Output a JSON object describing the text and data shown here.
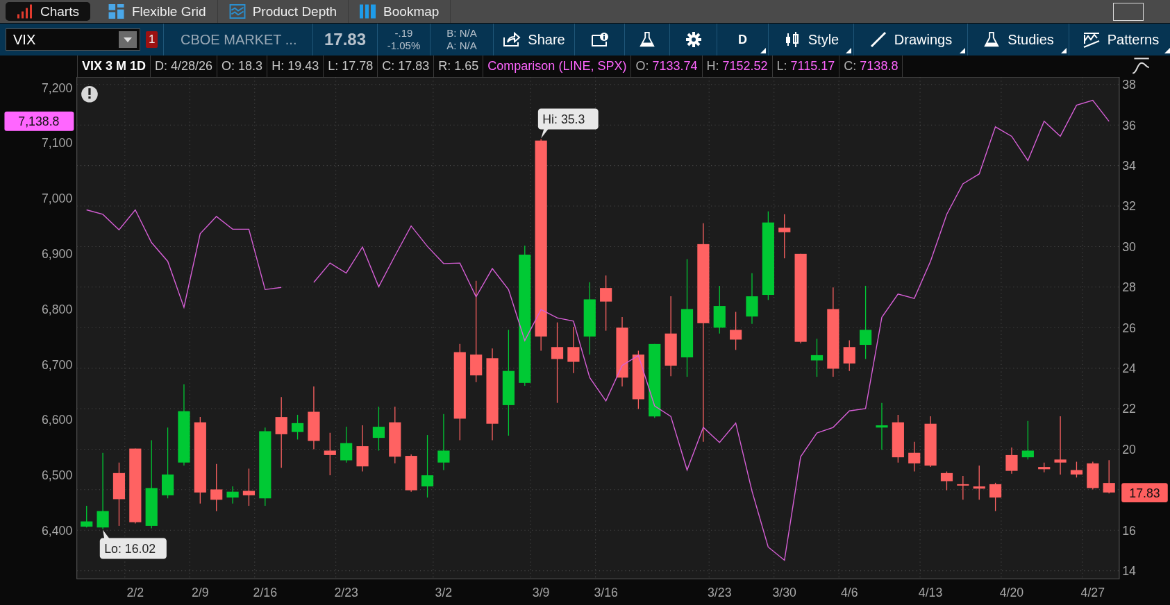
{
  "tabs": [
    {
      "label": "Charts",
      "kind": "charts",
      "selected": true
    },
    {
      "label": "Flexible Grid",
      "kind": "grid",
      "selected": false
    },
    {
      "label": "Product Depth",
      "kind": "depth",
      "selected": false
    },
    {
      "label": "Bookmap",
      "kind": "bookmap",
      "selected": false
    }
  ],
  "toolbar": {
    "symbol": "VIX",
    "alert_count": "1",
    "description": "CBOE MARKET ...",
    "last": "17.83",
    "change": "-.19",
    "change_pct": "-1.05%",
    "bid": "B: N/A",
    "ask": "A: N/A",
    "buttons": [
      {
        "kind": "share",
        "label": "Share",
        "dropdown": false
      },
      {
        "kind": "info",
        "dropdown": false
      },
      {
        "kind": "flask",
        "dropdown": false
      },
      {
        "kind": "gear",
        "dropdown": false
      },
      {
        "kind": "text",
        "label": "D",
        "dropdown": true
      },
      {
        "kind": "style",
        "label": "Style",
        "dropdown": true
      },
      {
        "kind": "drawings",
        "label": "Drawings",
        "dropdown": true
      },
      {
        "kind": "studies",
        "label": "Studies",
        "dropdown": true
      },
      {
        "kind": "patterns",
        "label": "Patterns",
        "dropdown": true
      }
    ]
  },
  "header": {
    "title": "VIX 3 M 1D",
    "fields": [
      "D: 4/28/26",
      "O: 18.3",
      "H: 19.43",
      "L: 17.78",
      "C: 17.83",
      "R: 1.65"
    ],
    "comparison": {
      "label": "Comparison (LINE, SPX)",
      "fields": [
        {
          "name": "O:",
          "value": "7133.74"
        },
        {
          "name": "H:",
          "value": "7152.52"
        },
        {
          "name": "L:",
          "value": "7115.17"
        },
        {
          "name": "C:",
          "value": "7138.8"
        }
      ]
    }
  },
  "chart": {
    "callouts": [
      "Hi: 35.3",
      "Lo: 16.02"
    ],
    "right_axis": [
      {
        "kind": "label",
        "text": "38"
      },
      {
        "kind": "label",
        "text": "36"
      },
      {
        "kind": "label",
        "text": "34"
      },
      {
        "kind": "label",
        "text": "32"
      },
      {
        "kind": "label",
        "text": "30"
      },
      {
        "kind": "label",
        "text": "28"
      },
      {
        "kind": "label",
        "text": "26"
      },
      {
        "kind": "label",
        "text": "24"
      },
      {
        "kind": "label",
        "text": "22"
      },
      {
        "kind": "label",
        "text": "20"
      },
      {
        "kind": "tag",
        "text": "17.83",
        "color": "#ff5f5f"
      },
      {
        "kind": "label",
        "text": "16"
      },
      {
        "kind": "label",
        "text": "14"
      }
    ],
    "chart_data": {
      "type": "line",
      "grid": true,
      "categories": [
        null,
        null,
        null,
        "2/2",
        null,
        null,
        null,
        "2/9",
        null,
        null,
        null,
        "2/16",
        null,
        null,
        null,
        null,
        "2/23",
        null,
        null,
        null,
        null,
        null,
        "3/2",
        null,
        null,
        null,
        null,
        null,
        "3/9",
        null,
        null,
        null,
        "3/16",
        null,
        null,
        null,
        null,
        null,
        null,
        "3/23",
        null,
        null,
        null,
        "3/30",
        null,
        null,
        null,
        "4/6",
        null,
        null,
        null,
        null,
        "4/13",
        null,
        null,
        null,
        null,
        "4/20",
        null,
        null,
        null,
        null,
        "4/27",
        null
      ],
      "ylim": [
        6312.5,
        7218.9
      ],
      "yticks": [
        {
          "value": 6400,
          "label": "6,400"
        },
        {
          "value": 6500,
          "label": "6,500"
        },
        {
          "value": 6600,
          "label": "6,600"
        },
        {
          "value": 6700,
          "label": "6,700"
        },
        {
          "value": 6800,
          "label": "6,800"
        },
        {
          "value": 6900,
          "label": "6,900"
        },
        {
          "value": 7000,
          "label": "7,000"
        },
        {
          "value": 7100,
          "label": "7,100"
        },
        {
          "value": 7200,
          "label": "7,200"
        }
      ],
      "series": [
        {
          "color": "#d75fd7",
          "values": [
            6979,
            6971,
            6943,
            6979,
            6920,
            6886,
            6803,
            6936,
            6967,
            6944,
            6944,
            6835,
            6839,
            null,
            6848,
            6883,
            6865,
            6912,
            6840,
            6896,
            6950,
            6913,
            6882,
            6883,
            6822,
            6873,
            6835,
            6743,
            6799,
            6784,
            6778,
            6676,
            6634,
            6698,
            6716,
            6625,
            6606,
            6509,
            6586,
            6559,
            6594,
            6471,
            6370,
            6346,
            6533,
            6576,
            6586,
            6616,
            6620,
            6785,
            6827,
            6819,
            6886,
            6971,
            7026,
            7044,
            7129,
            7112,
            7068,
            7139,
            7112,
            7168,
            7177,
            7139
          ]
        }
      ],
      "annotations": [
        "7,138.8"
      ]
    }
  }
}
